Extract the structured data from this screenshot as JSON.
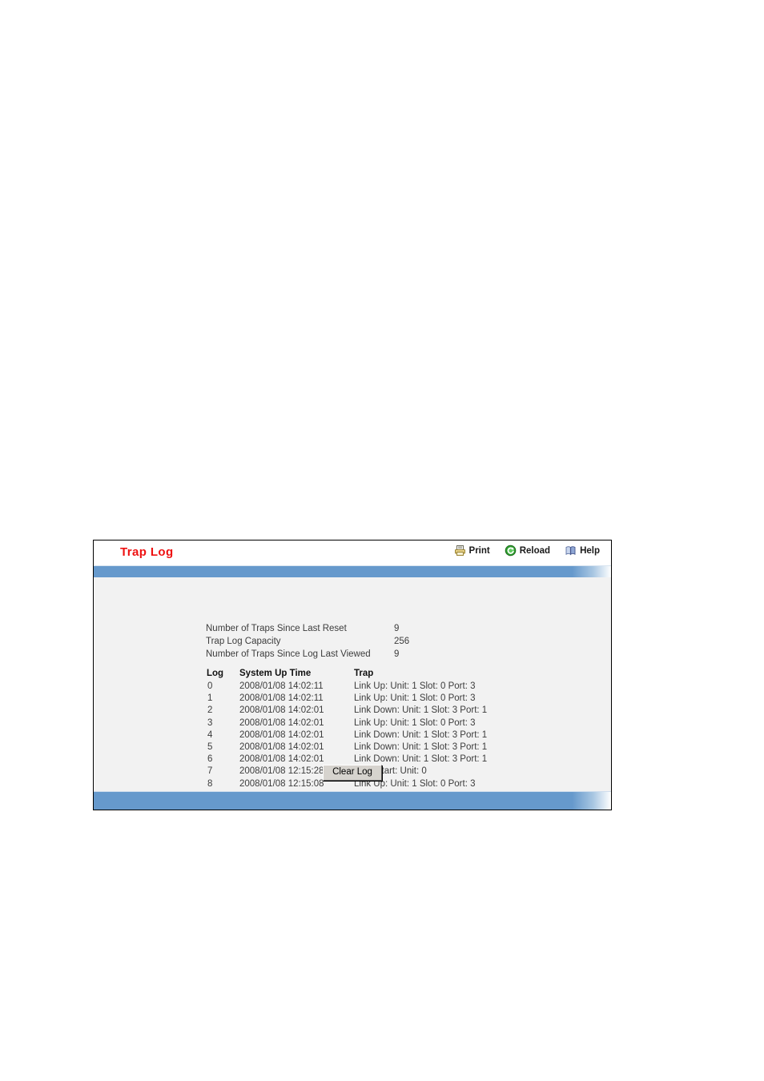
{
  "panel": {
    "title": "Trap Log",
    "title_color": "#ee1111",
    "accent_color": "#6699cc"
  },
  "toolbar": {
    "items": [
      {
        "label": "Print",
        "icon": "printer-icon"
      },
      {
        "label": "Reload",
        "icon": "refresh-icon"
      },
      {
        "label": "Help",
        "icon": "book-help-icon"
      }
    ]
  },
  "summary": {
    "rows": [
      {
        "label": "Number of Traps Since Last Reset",
        "value": "9"
      },
      {
        "label": "Trap Log Capacity",
        "value": "256"
      },
      {
        "label": "Number of Traps Since Log Last Viewed",
        "value": "9"
      }
    ]
  },
  "log_table": {
    "headers": [
      "Log",
      "System Up Time",
      "Trap"
    ],
    "rows": [
      {
        "log": "0",
        "time": "2008/01/08 14:02:11",
        "trap": "Link Up: Unit: 1 Slot: 0 Port: 3"
      },
      {
        "log": "1",
        "time": "2008/01/08 14:02:11",
        "trap": "Link Up: Unit: 1 Slot: 0 Port: 3"
      },
      {
        "log": "2",
        "time": "2008/01/08 14:02:01",
        "trap": "Link Down: Unit: 1 Slot: 3 Port: 1"
      },
      {
        "log": "3",
        "time": "2008/01/08 14:02:01",
        "trap": "Link Up: Unit: 1 Slot: 0 Port: 3"
      },
      {
        "log": "4",
        "time": "2008/01/08 14:02:01",
        "trap": "Link Down: Unit: 1 Slot: 3 Port: 1"
      },
      {
        "log": "5",
        "time": "2008/01/08 14:02:01",
        "trap": "Link Down: Unit: 1 Slot: 3 Port: 1"
      },
      {
        "log": "6",
        "time": "2008/01/08 14:02:01",
        "trap": "Link Down: Unit: 1 Slot: 3 Port: 1"
      },
      {
        "log": "7",
        "time": "2008/01/08 12:15:28",
        "trap": "Cold Start: Unit: 0"
      },
      {
        "log": "8",
        "time": "2008/01/08 12:15:08",
        "trap": "Link Up: Unit: 1 Slot: 0 Port: 3"
      }
    ]
  },
  "actions": {
    "clear_log_label": "Clear Log"
  }
}
